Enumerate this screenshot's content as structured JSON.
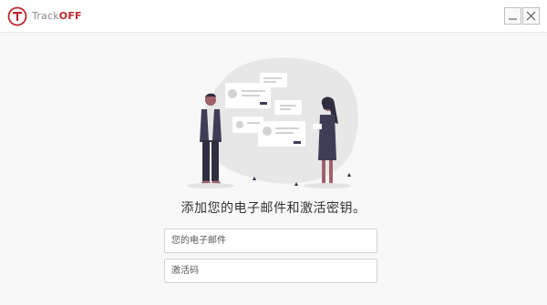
{
  "app": {
    "logo_letter": "T",
    "logo_text_part1": "Track",
    "logo_text_part2": "OFF",
    "brand_color": "#c0272d"
  },
  "window_controls": {
    "minimize_icon": "minimize-icon",
    "close_icon": "close-icon"
  },
  "main": {
    "prompt": "添加您的电子邮件和激活密钥。",
    "email_placeholder": "您的电子邮件",
    "email_value": "",
    "code_placeholder": "激活码",
    "code_value": ""
  }
}
